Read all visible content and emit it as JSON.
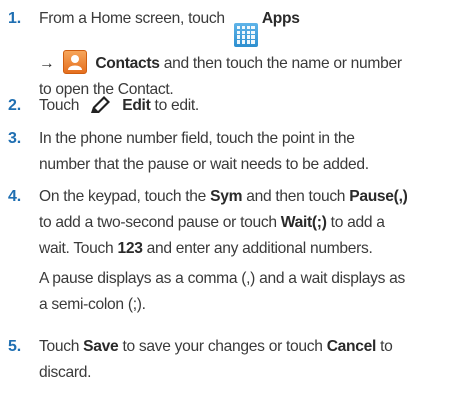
{
  "steps": [
    {
      "num": "1.",
      "t1": "From a Home screen, touch",
      "t1b": "Apps",
      "t2": "→",
      "t2b": "Contacts",
      "t3": "and then touch the name or number",
      "t4": "to open the Contact."
    },
    {
      "num": "2.",
      "t1": "Touch",
      "t1b": "Edit",
      "t2": "to edit."
    },
    {
      "num": "3.",
      "t1": "In the phone number field, touch the point in the",
      "t2": "number that the pause or wait needs to be added."
    },
    {
      "num": "4.",
      "t1": "On the keypad, touch the",
      "t1b": "Sym",
      "t1c": "and then touch",
      "t1d": "Pause(,)",
      "t2": "to add a two-second pause or touch",
      "t2b": "Wait(;)",
      "t2c": "to add a",
      "t3": "wait. Touch",
      "t3b": "123",
      "t3c": "and enter any additional numbers.",
      "note1": "A pause displays as a comma (,) and a wait displays as",
      "note2": "a semi-colon (;)."
    },
    {
      "num": "5.",
      "t1": "Touch",
      "t1b": "Save",
      "t1c": "to save your changes or touch",
      "t1d": "Cancel",
      "t1e": "to",
      "t2": "discard."
    }
  ],
  "icons": {
    "apps": "apps-grid-icon",
    "contacts": "contacts-person-icon",
    "edit": "edit-pencil-icon"
  },
  "colors": {
    "step_number": "#1f6fb2",
    "apps_icon": "#2d8fcf",
    "contacts_icon": "#e56f1f"
  }
}
